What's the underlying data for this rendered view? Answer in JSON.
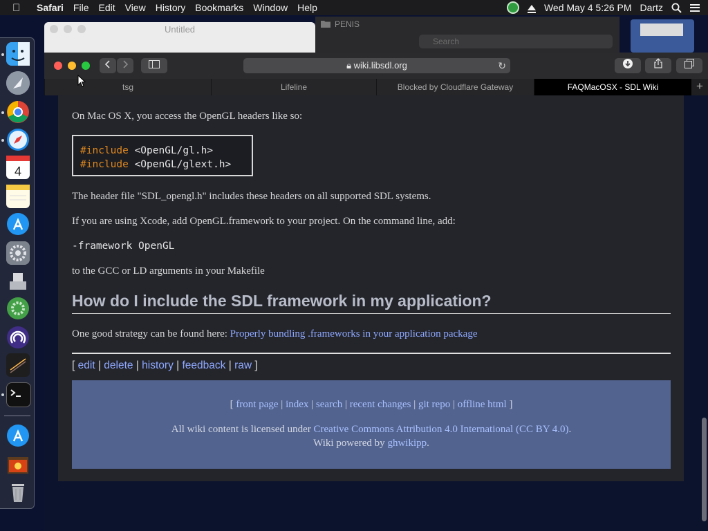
{
  "menubar": {
    "app": "Safari",
    "items": [
      "File",
      "Edit",
      "View",
      "History",
      "Bookmarks",
      "Window",
      "Help"
    ],
    "clock": "Wed May 4  5:26 PM",
    "user": "Dartz"
  },
  "background_window": {
    "title": "Untitled"
  },
  "finder": {
    "folder": "PENIS",
    "search_placeholder": "Search"
  },
  "safari": {
    "url": "wiki.libsdl.org",
    "tabs": [
      "tsg",
      "Lifeline",
      "Blocked by Cloudflare Gateway",
      "FAQMacOSX - SDL Wiki"
    ],
    "active_tab": 3
  },
  "page": {
    "p1": "On Mac OS X, you access the OpenGL headers like so:",
    "code_kw": "#include",
    "code1": "<OpenGL/gl.h>",
    "code2": "<OpenGL/glext.h>",
    "p2": "The header file \"SDL_opengl.h\" includes these headers on all supported SDL systems.",
    "p3": "If you are using Xcode, add OpenGL.framework to your project. On the command line, add:",
    "cmd": "-framework OpenGL",
    "p4": "to the GCC or LD arguments in your Makefile",
    "heading": "How do I include the SDL framework in my application?",
    "p5_text": "One good strategy can be found here: ",
    "p5_link": "Properly bundling .frameworks in your application package",
    "actions": {
      "open": "[",
      "close": "]",
      "sep": "|",
      "items": [
        "edit",
        "delete",
        "history",
        "feedback",
        "raw"
      ]
    },
    "footer": {
      "links": [
        "front page",
        "index",
        "search",
        "recent changes",
        "git repo",
        "offline html"
      ],
      "license_text": "All wiki content is licensed under ",
      "license_link": "Creative Commons Attribution 4.0 International (CC BY 4.0)",
      "license_end": ".",
      "powered_text": "Wiki powered by ",
      "powered_link": "ghwikipp",
      "powered_end": "."
    }
  }
}
